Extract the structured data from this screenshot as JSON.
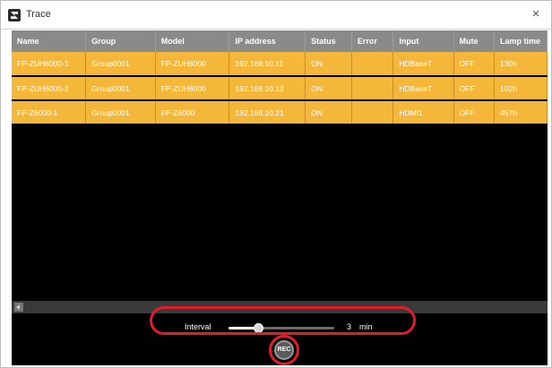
{
  "window": {
    "title": "Trace",
    "close_symbol": "×"
  },
  "table": {
    "columns": [
      "Name",
      "Group",
      "Model",
      "IP address",
      "Status",
      "Error",
      "Input",
      "Mute",
      "Lamp time"
    ],
    "rows": [
      [
        "FP-ZUH6000-1",
        "Group0001",
        "FP-ZUH6000",
        "192.168.10.11",
        "ON",
        "",
        "HDBaseT",
        "OFF",
        "130h"
      ],
      [
        "FP-ZUH6000-2",
        "Group0001",
        "FP-ZUH6000",
        "192.168.10.12",
        "ON",
        "",
        "HDBaseT",
        "OFF",
        "102h"
      ],
      [
        "FP-Z6000-1",
        "Group0001",
        "FP-Z6000",
        "192.168.10.21",
        "ON",
        "",
        "HDMI1",
        "OFF",
        "457h"
      ]
    ]
  },
  "interval": {
    "label": "Interval",
    "value": "3",
    "unit": "min",
    "slider_fraction": 0.28
  },
  "rec_button": {
    "label": "REC"
  },
  "colors": {
    "row_background": "#f5b73a",
    "header_background": "#8a8a8a",
    "highlight": "#e11d2a",
    "content_background": "#000000"
  }
}
